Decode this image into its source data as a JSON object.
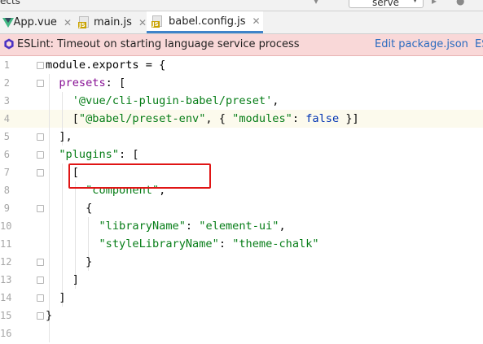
{
  "toolbar": {
    "title_fragment": "ects",
    "run_config_label": "serve"
  },
  "tabs": [
    {
      "label": "App.vue",
      "icon": "vue-file-icon",
      "active": false
    },
    {
      "label": "main.js",
      "icon": "js-file-icon",
      "active": false
    },
    {
      "label": "babel.config.js",
      "icon": "js-file-icon",
      "active": true
    }
  ],
  "banner": {
    "message": "ESLint: Timeout on starting language service process",
    "edit_link": "Edit package.json",
    "extra_link": "ES",
    "background": "#f9d8d8"
  },
  "editor": {
    "line_numbers": [
      "1",
      "2",
      "3",
      "4",
      "5",
      "6",
      "7",
      "8",
      "9",
      "10",
      "11",
      "12",
      "13",
      "14",
      "15",
      "16"
    ],
    "current_line": 4,
    "highlighted_text": "[\"@babel/preset-env\",",
    "lines": [
      [
        {
          "t": "id",
          "v": "module.exports"
        },
        {
          "t": "p",
          "v": " = {"
        }
      ],
      [
        {
          "t": "p",
          "v": "  "
        },
        {
          "t": "key",
          "v": "presets"
        },
        {
          "t": "p",
          "v": ": ["
        }
      ],
      [
        {
          "t": "p",
          "v": "    "
        },
        {
          "t": "str",
          "v": "'@vue/cli-plugin-babel/preset'"
        },
        {
          "t": "p",
          "v": ","
        }
      ],
      [
        {
          "t": "p",
          "v": "    ["
        },
        {
          "t": "str",
          "v": "\"@babel/preset-env\""
        },
        {
          "t": "p",
          "v": ", { "
        },
        {
          "t": "str",
          "v": "\"modules\""
        },
        {
          "t": "p",
          "v": ": "
        },
        {
          "t": "kw",
          "v": "false"
        },
        {
          "t": "p",
          "v": " }]"
        }
      ],
      [
        {
          "t": "p",
          "v": "  ],"
        }
      ],
      [
        {
          "t": "p",
          "v": "  "
        },
        {
          "t": "str",
          "v": "\"plugins\""
        },
        {
          "t": "p",
          "v": ": ["
        }
      ],
      [
        {
          "t": "p",
          "v": "    ["
        }
      ],
      [
        {
          "t": "p",
          "v": "      "
        },
        {
          "t": "str",
          "v": "\"component\""
        },
        {
          "t": "p",
          "v": ","
        }
      ],
      [
        {
          "t": "p",
          "v": "      {"
        }
      ],
      [
        {
          "t": "p",
          "v": "        "
        },
        {
          "t": "str",
          "v": "\"libraryName\""
        },
        {
          "t": "p",
          "v": ": "
        },
        {
          "t": "str",
          "v": "\"element-ui\""
        },
        {
          "t": "p",
          "v": ","
        }
      ],
      [
        {
          "t": "p",
          "v": "        "
        },
        {
          "t": "str",
          "v": "\"styleLibraryName\""
        },
        {
          "t": "p",
          "v": ": "
        },
        {
          "t": "str",
          "v": "\"theme-chalk\""
        }
      ],
      [
        {
          "t": "p",
          "v": "      }"
        }
      ],
      [
        {
          "t": "p",
          "v": "    ]"
        }
      ],
      [
        {
          "t": "p",
          "v": "  ]"
        }
      ],
      [
        {
          "t": "p",
          "v": "}"
        }
      ],
      []
    ]
  }
}
